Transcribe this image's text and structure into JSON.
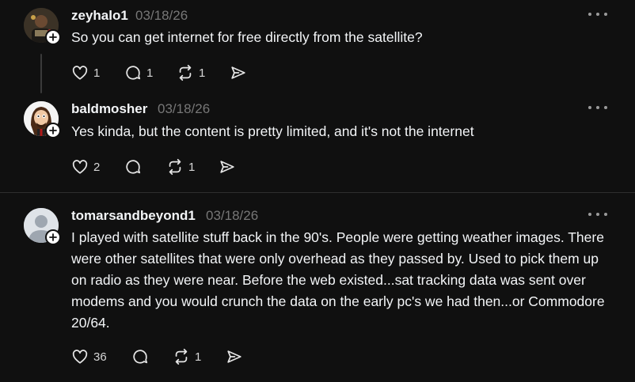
{
  "posts": [
    {
      "username": "zeyhalo1",
      "date": "03/18/26",
      "text": "So you can get internet for free directly from the satellite?",
      "likes": "1",
      "replies": "1",
      "reposts": "1"
    },
    {
      "username": "baldmosher",
      "date": "03/18/26",
      "text": "Yes kinda, but the content is pretty limited, and it's not the internet",
      "likes": "2",
      "replies": "",
      "reposts": "1"
    },
    {
      "username": "tomarsandbeyond1",
      "date": "03/18/26",
      "text": "I played with satellite stuff back in the 90's. People were getting weather images. There were other satellites that were only overhead as they passed by. Used to pick them up on radio as they were near. Before the web existed...sat tracking data was sent over modems and you would crunch the data on the early pc's we had then...or Commodore 20/64.",
      "likes": "36",
      "replies": "",
      "reposts": "1"
    }
  ],
  "colors": {
    "background": "#101010",
    "text": "#f3f5f7",
    "muted": "#777777",
    "divider": "#2e2e2e"
  },
  "icons": [
    "heart-icon",
    "comment-icon",
    "repost-icon",
    "share-icon",
    "more-icon",
    "follow-plus-icon"
  ]
}
